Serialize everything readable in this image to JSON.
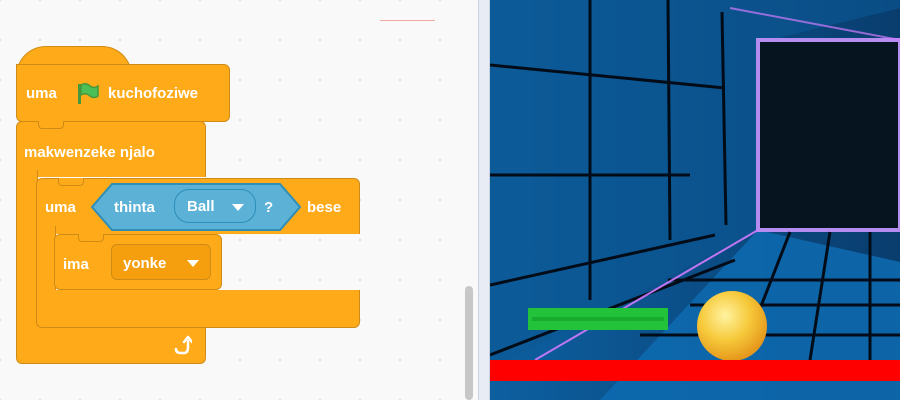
{
  "blocks": {
    "hat": {
      "prefix": "uma",
      "suffix": "kuchofoziwe",
      "icon": "green-flag-icon"
    },
    "forever": {
      "label": "makwenzeke njalo",
      "loop_icon": "loop-arrow-icon"
    },
    "if_block": {
      "prefix": "uma",
      "suffix": "bese"
    },
    "touching": {
      "label": "thinta",
      "target": "Ball",
      "question": "?"
    },
    "stop": {
      "label": "ima",
      "option": "yonke"
    }
  },
  "stage": {
    "paddle_color": "#22c33a",
    "floor_color": "#ff0000",
    "ball_color": "#f6b81e"
  },
  "colors": {
    "events": "#ffab19",
    "sensing": "#5cb1d6"
  }
}
